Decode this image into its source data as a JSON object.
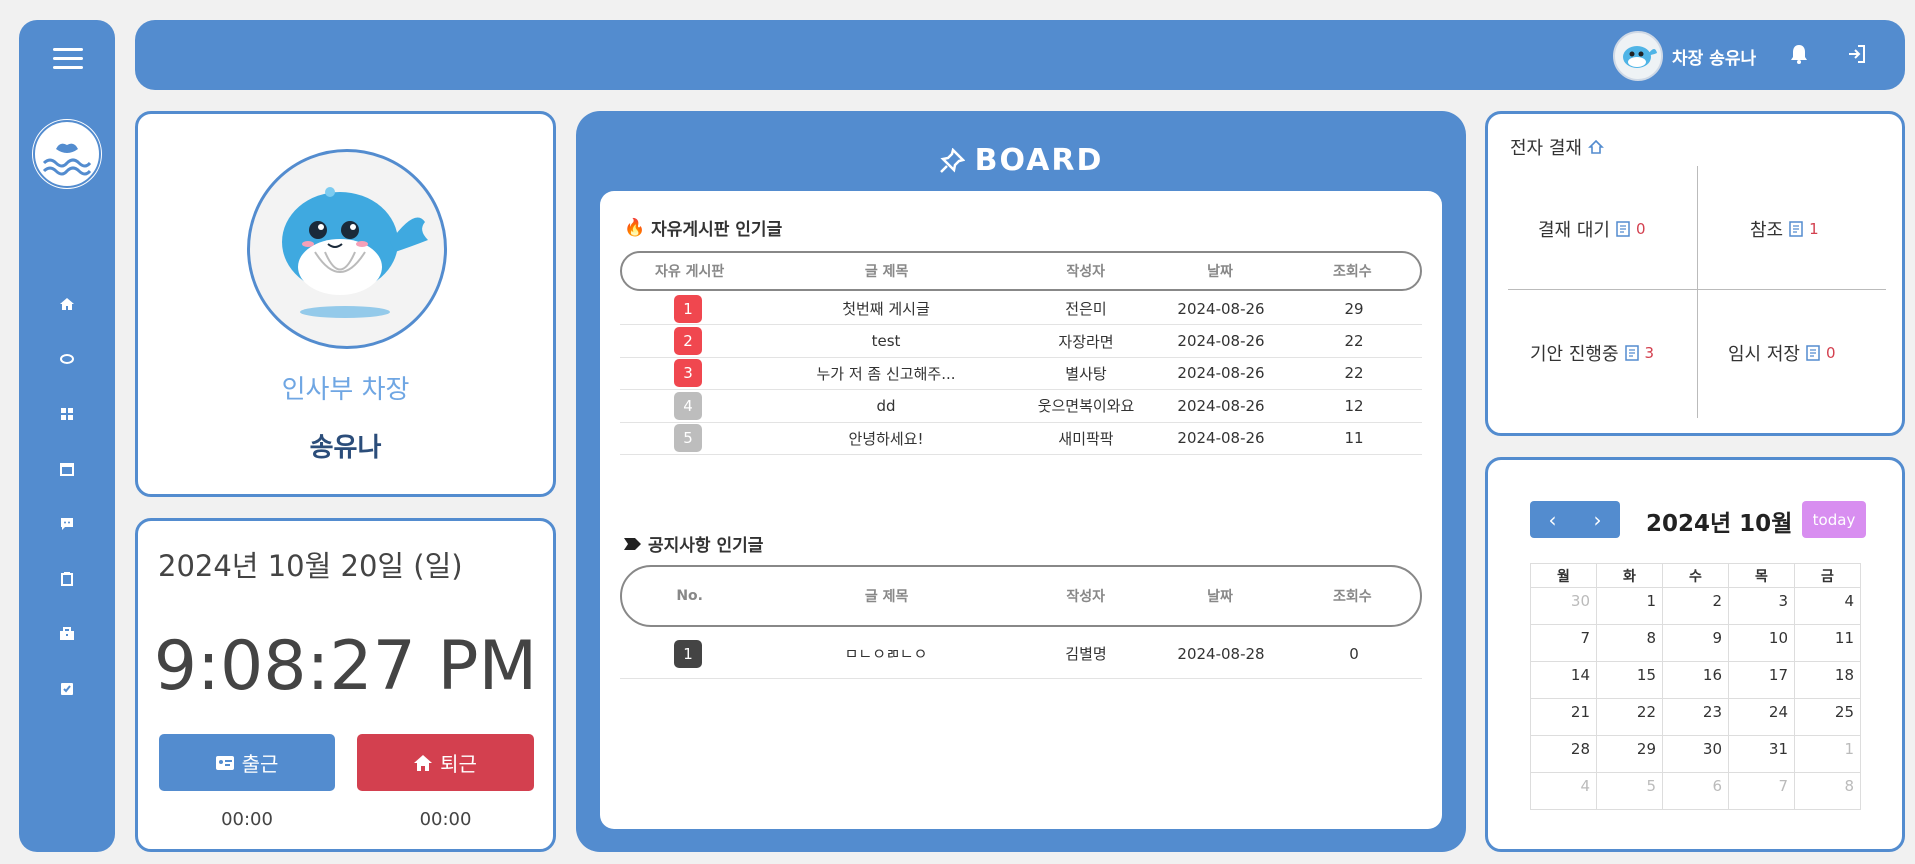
{
  "topbar": {
    "user_label": "차장 송유나"
  },
  "profile": {
    "dept": "인사부 차장",
    "name": "송유나"
  },
  "attendance": {
    "date": "2024년 10월 20일 (일)",
    "time": "9:08:27 PM",
    "checkin_label": "출근",
    "checkout_label": "퇴근",
    "checkin_time": "00:00",
    "checkout_time": "00:00"
  },
  "board": {
    "title": "BOARD",
    "free": {
      "title": "자유게시판 인기글",
      "headers": [
        "자유 게시판",
        "글 제목",
        "작성자",
        "날짜",
        "조회수"
      ],
      "rows": [
        {
          "rank": "1",
          "title": "첫번째 게시글",
          "author": "전은미",
          "date": "2024-08-26",
          "views": "29"
        },
        {
          "rank": "2",
          "title": "test",
          "author": "자장라면",
          "date": "2024-08-26",
          "views": "22"
        },
        {
          "rank": "3",
          "title": "누가 저 좀 신고해주...",
          "author": "별사탕",
          "date": "2024-08-26",
          "views": "22"
        },
        {
          "rank": "4",
          "title": "dd",
          "author": "웃으면복이와요",
          "date": "2024-08-26",
          "views": "12"
        },
        {
          "rank": "5",
          "title": "안녕하세요!",
          "author": "새미팍팍",
          "date": "2024-08-26",
          "views": "11"
        }
      ]
    },
    "notice": {
      "title": "공지사항 인기글",
      "headers": [
        "No.",
        "글 제목",
        "작성자",
        "날짜",
        "조회수"
      ],
      "rows": [
        {
          "rank": "1",
          "title": "ㅁㄴㅇㄻㄴㅇ",
          "author": "김별명",
          "date": "2024-08-28",
          "views": "0"
        }
      ]
    }
  },
  "approval": {
    "title": "전자 결재",
    "items": [
      {
        "label": "결재 대기",
        "count": "0"
      },
      {
        "label": "참조",
        "count": "1"
      },
      {
        "label": "기안 진행중",
        "count": "3"
      },
      {
        "label": "임시 저장",
        "count": "0"
      }
    ]
  },
  "calendar": {
    "title": "2024년 10월",
    "today_label": "today",
    "weekdays": [
      "월",
      "화",
      "수",
      "목",
      "금"
    ],
    "weeks": [
      [
        "30",
        "1",
        "2",
        "3",
        "4"
      ],
      [
        "7",
        "8",
        "9",
        "10",
        "11"
      ],
      [
        "14",
        "15",
        "16",
        "17",
        "18"
      ],
      [
        "21",
        "22",
        "23",
        "24",
        "25"
      ],
      [
        "28",
        "29",
        "30",
        "31",
        "1"
      ],
      [
        "4",
        "5",
        "6",
        "7",
        "8"
      ]
    ]
  },
  "colors": {
    "primary": "#538ccf",
    "danger": "#d3404f",
    "rank_hot": "#f0474f",
    "rank_gray": "#bdbdbd",
    "rank_dark": "#444444",
    "today": "#d88ef0"
  },
  "icons": {
    "sidebar": [
      "home-icon",
      "paperclip-icon",
      "grid-icon",
      "calendar-icon",
      "chat-icon",
      "clipboard-icon",
      "briefcase-icon",
      "checkbox-icon"
    ]
  }
}
